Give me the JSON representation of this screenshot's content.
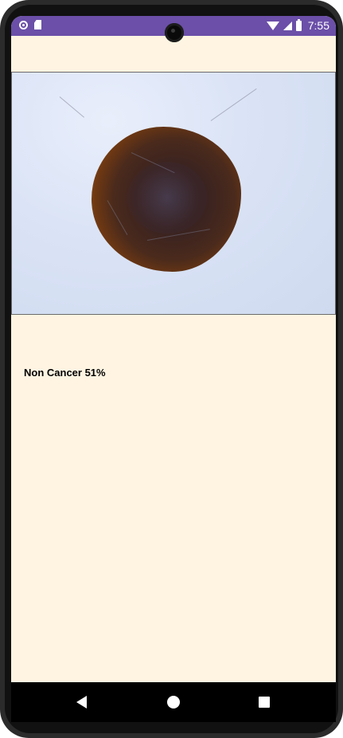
{
  "status_bar": {
    "time": "7:55",
    "left_icons": [
      "notification-ring-icon",
      "sd-card-icon"
    ],
    "right_icons": [
      "wifi-icon",
      "cell-signal-icon",
      "battery-icon"
    ],
    "color": "#6b4fa8"
  },
  "app": {
    "background_color": "#fff4e2",
    "image_subject": "skin-lesion-photo",
    "result_text": "Non Cancer 51%"
  },
  "nav_bar": {
    "buttons": [
      "back-icon",
      "home-icon",
      "recents-icon"
    ]
  }
}
